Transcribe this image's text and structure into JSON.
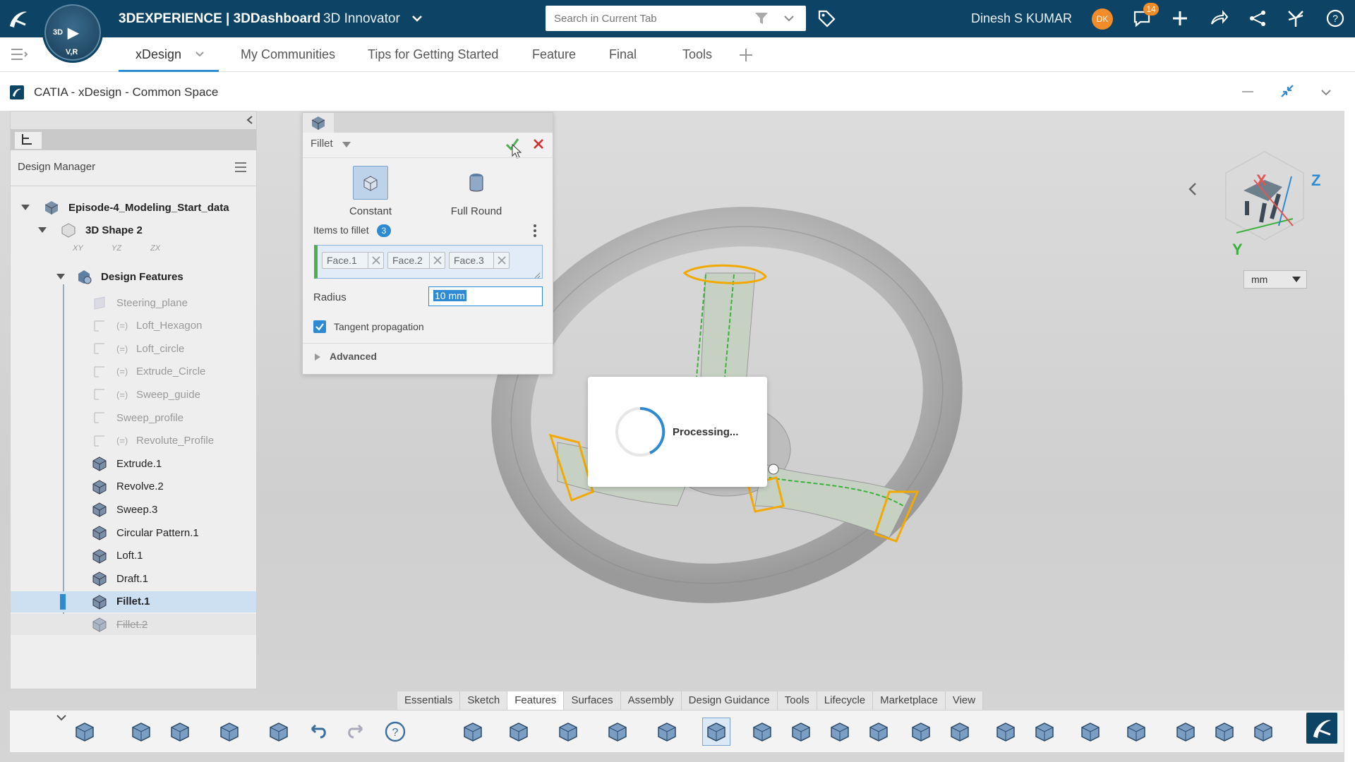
{
  "topbar": {
    "brand": "3DEXPERIENCE | 3DDashboard",
    "role": "3D Innovator",
    "search_placeholder": "Search in Current Tab",
    "user_name": "Dinesh S KUMAR",
    "user_initials": "DK",
    "notifications": "14",
    "compass": {
      "top": "3D",
      "play": "▶",
      "bottom": "V,R"
    }
  },
  "tabs": [
    "xDesign",
    "My Communities",
    "Tips for Getting Started",
    "Feature",
    "Final",
    "Tools"
  ],
  "app_title": "CATIA - xDesign - Common Space",
  "tree": {
    "title": "Design Manager",
    "root": "Episode-4_Modeling_Start_data",
    "shape": "3D Shape 2",
    "planes": [
      "XY",
      "YZ",
      "ZX"
    ],
    "design_features": "Design Features",
    "items": [
      {
        "label": "Steering_plane",
        "dim": true
      },
      {
        "label": "Loft_Hexagon",
        "dim": true
      },
      {
        "label": "Loft_circle",
        "dim": true
      },
      {
        "label": "Extrude_Circle",
        "dim": true
      },
      {
        "label": "Sweep_guide",
        "dim": true
      },
      {
        "label": "Sweep_profile",
        "dim": true
      },
      {
        "label": "Revolute_Profile",
        "dim": true
      },
      {
        "label": "Extrude.1",
        "dim": false
      },
      {
        "label": "Revolve.2",
        "dim": false
      },
      {
        "label": "Sweep.3",
        "dim": false
      },
      {
        "label": "Circular Pattern.1",
        "dim": false
      },
      {
        "label": "Loft.1",
        "dim": false
      },
      {
        "label": "Draft.1",
        "dim": false
      },
      {
        "label": "Fillet.1",
        "dim": false
      },
      {
        "label": "Fillet.2",
        "dim": true
      }
    ]
  },
  "fillet": {
    "title": "Fillet",
    "type_constant": "Constant",
    "type_full_round": "Full Round",
    "items_label": "Items to fillet",
    "items_count": "3",
    "faces": [
      "Face.1",
      "Face.2",
      "Face.3"
    ],
    "radius_label": "Radius",
    "radius_value": "10 mm",
    "tangent_label": "Tangent propagation",
    "tangent_checked": true,
    "advanced_label": "Advanced"
  },
  "processing_text": "Processing...",
  "units": "mm",
  "axes": {
    "x": "X",
    "y": "Y",
    "z": "Z"
  },
  "bottom_tabs": [
    "Essentials",
    "Sketch",
    "Features",
    "Surfaces",
    "Assembly",
    "Design Guidance",
    "Tools",
    "Lifecycle",
    "Marketplace",
    "View"
  ],
  "bottom_active_tab": "Features",
  "colors": {
    "topbar": "#0d4466",
    "accent": "#2e8bd3",
    "selection": "#f2a900",
    "confirm": "#4caf50",
    "cancel": "#d32f2f"
  }
}
